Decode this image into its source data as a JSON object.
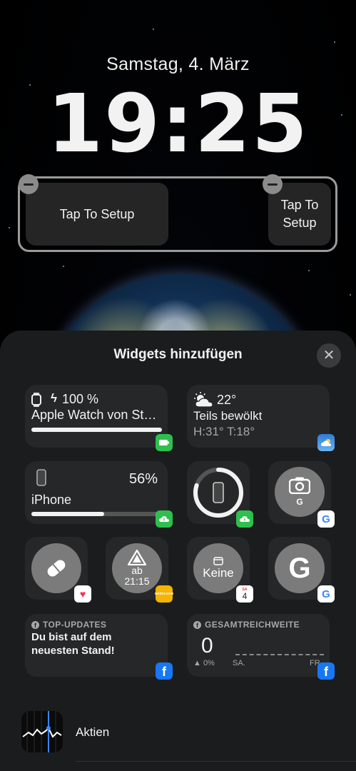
{
  "lockscreen": {
    "date": "Samstag, 4. März",
    "time": "19:25",
    "widget_big_label": "Tap To Setup",
    "widget_small_label_line1": "Tap To",
    "widget_small_label_line2": "Setup"
  },
  "sheet": {
    "title": "Widgets hinzufügen",
    "close_symbol": "✕"
  },
  "widgets": {
    "watch": {
      "percent": "100 %",
      "name": "Apple Watch von St…",
      "charge_level": 1.0,
      "icon": "watch-icon"
    },
    "weather": {
      "temp": "22°",
      "condition": "Teils bewölkt",
      "range": "H:31° T:18°",
      "icon": "partly-cloudy-icon"
    },
    "iphone_battery": {
      "percent": "56%",
      "name": "iPhone",
      "charge_level": 0.56
    },
    "iphone_ring": {
      "charge_level": 0.8
    },
    "google_lens": {
      "letter": "G"
    },
    "health": {
      "icon": "pill-icon"
    },
    "warn": {
      "line1": "ab",
      "line2": "21:15",
      "badge_text": "wetter.com"
    },
    "calendar": {
      "label": "Keine",
      "badge_day": "SA",
      "badge_date": "4"
    },
    "google": {
      "letter": "G"
    },
    "fb_updates": {
      "header": "TOP-UPDATES",
      "message_line1": "Du bist auf dem",
      "message_line2": "neuesten Stand!"
    },
    "fb_reach": {
      "header": "GESAMTREICHWEITE",
      "value": "0",
      "change": "▲ 0%",
      "label_left": "SA.",
      "label_right": "FR."
    }
  },
  "list": {
    "aktien_label": "Aktien"
  },
  "colors": {
    "accent_green": "#36c759",
    "google_blue": "#4285f4",
    "facebook_blue": "#1877f2"
  }
}
